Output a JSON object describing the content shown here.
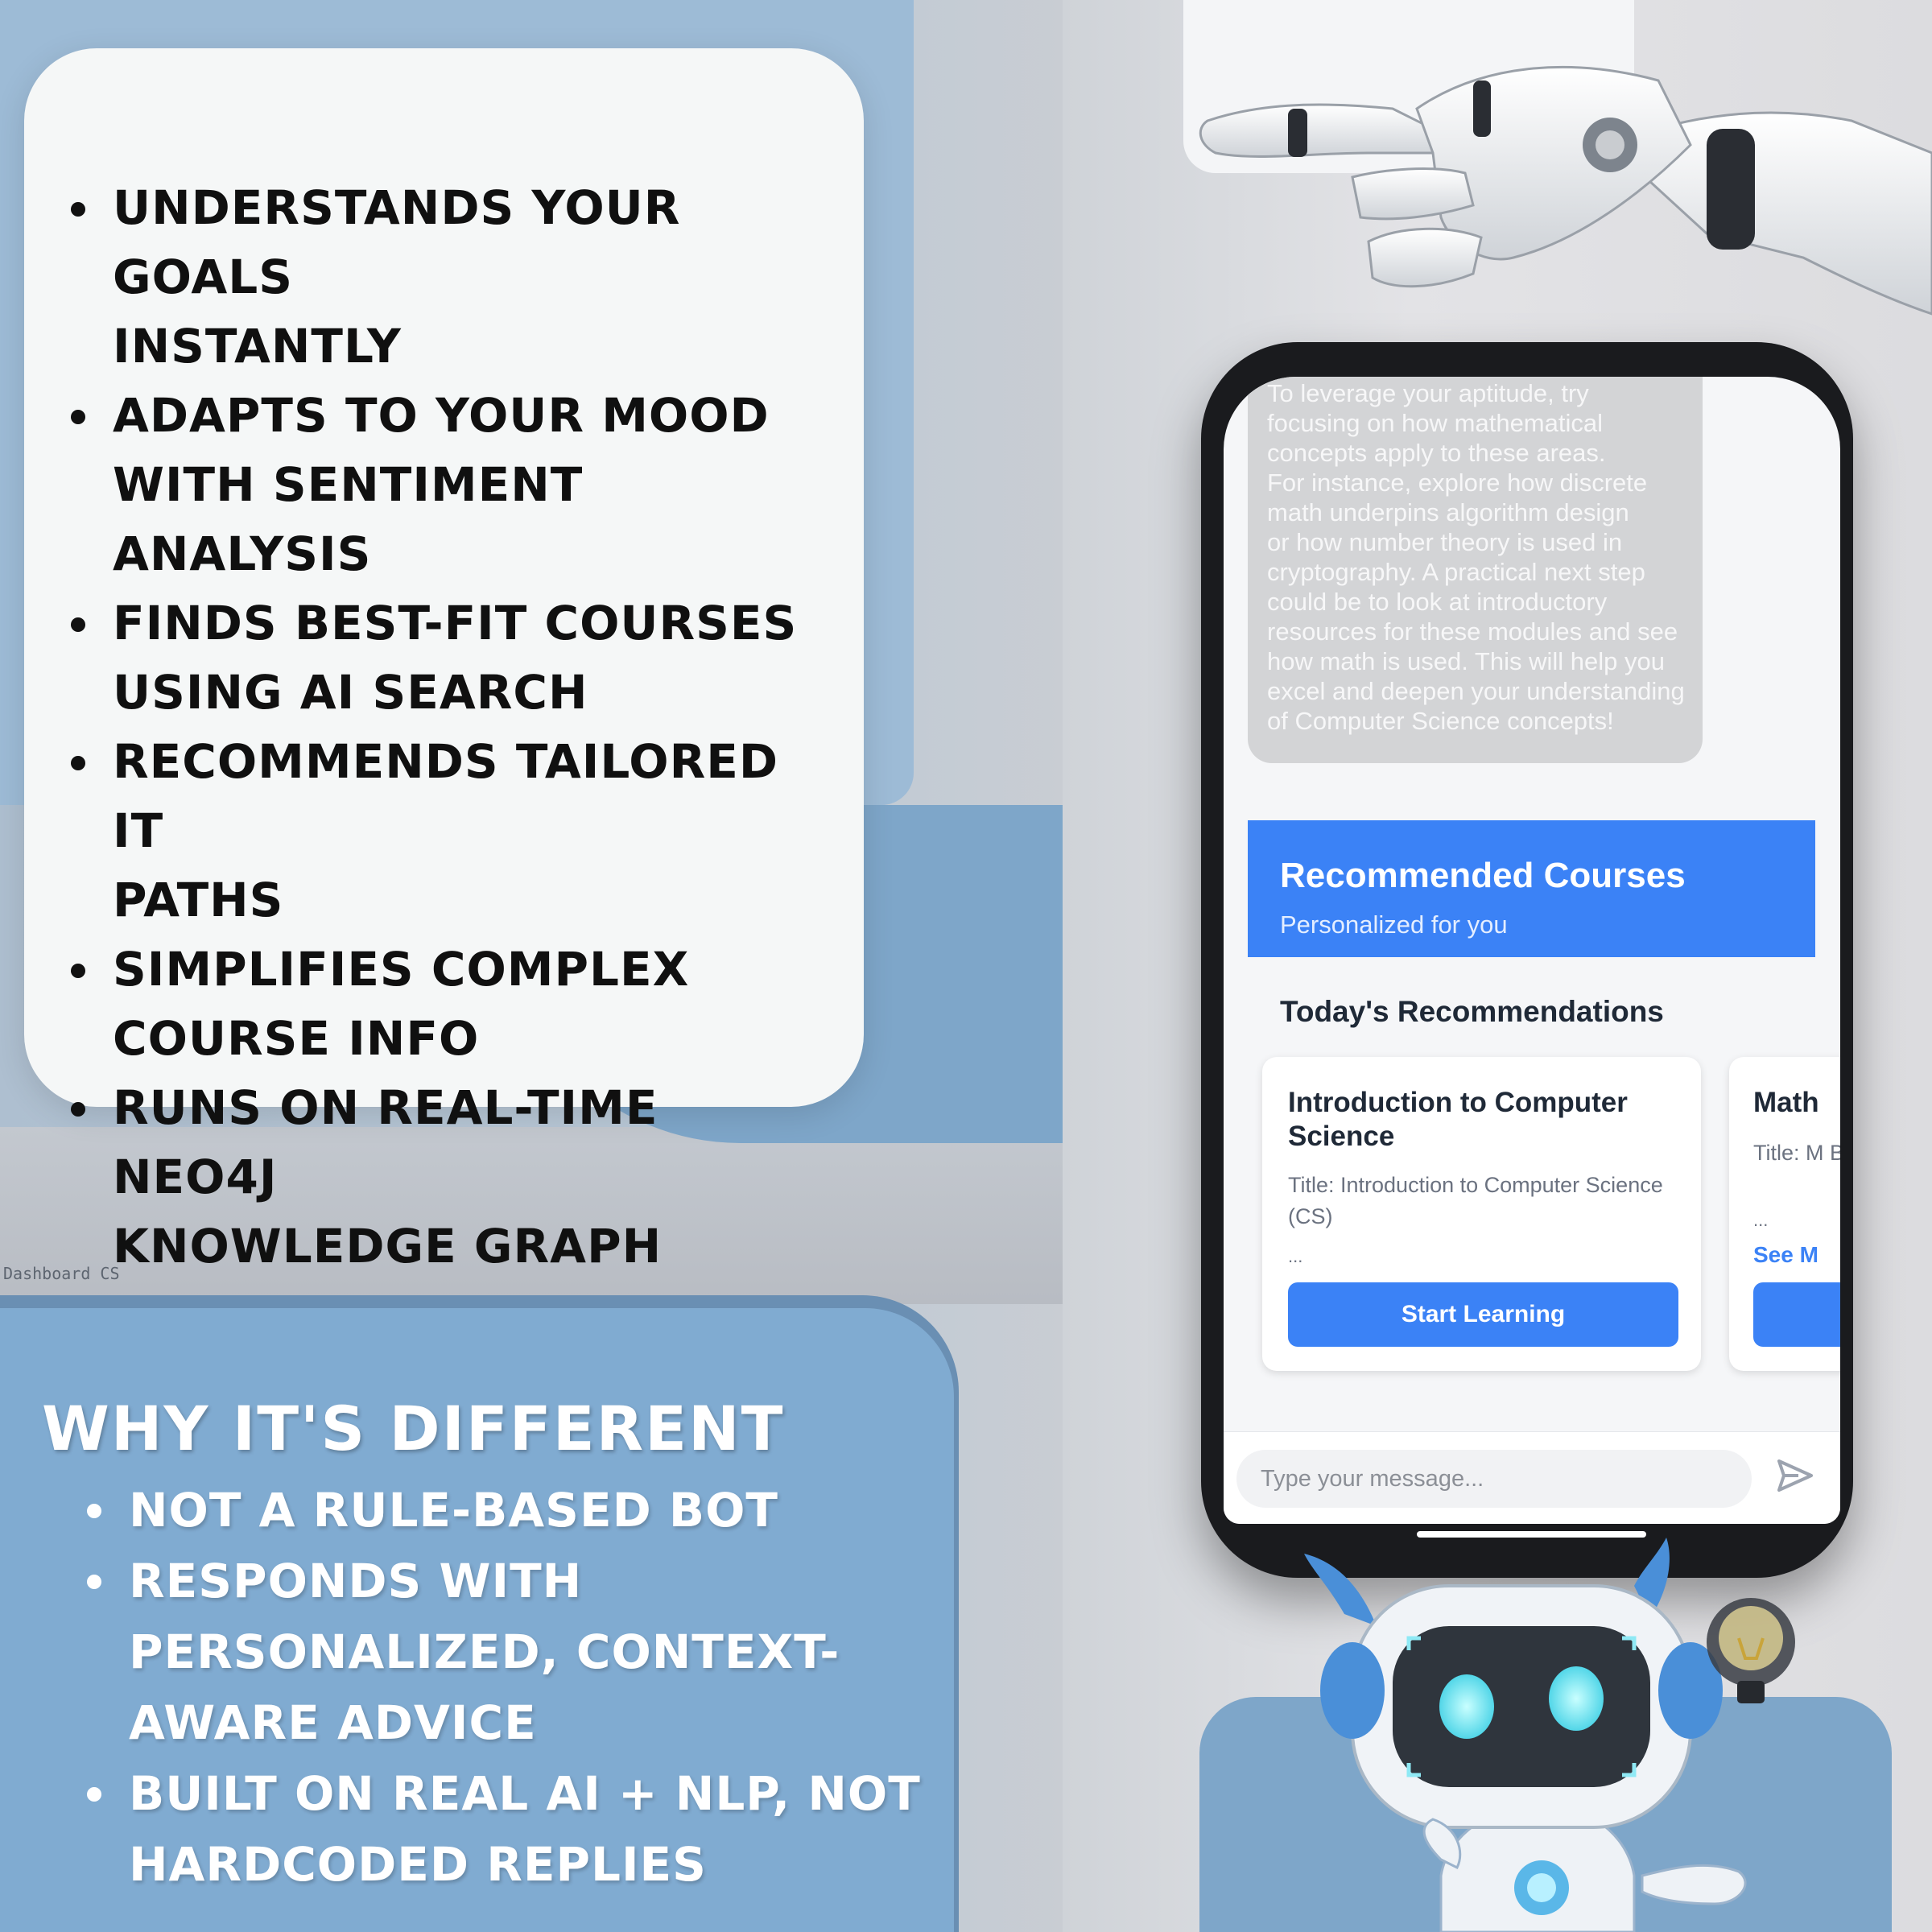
{
  "features": {
    "items": [
      [
        "UNDERSTANDS YOUR GOALS",
        "INSTANTLY"
      ],
      [
        "ADAPTS TO YOUR MOOD",
        "WITH SENTIMENT ANALYSIS"
      ],
      [
        "FINDS BEST-FIT COURSES",
        "USING AI SEARCH"
      ],
      [
        "RECOMMENDS TAILORED IT",
        "PATHS"
      ],
      [
        "SIMPLIFIES COMPLEX",
        "COURSE INFO"
      ],
      [
        "RUNS ON REAL-TIME NEO4J",
        "KNOWLEDGE GRAPH"
      ]
    ]
  },
  "why": {
    "title": "WHY IT'S DIFFERENT",
    "items": [
      [
        "NOT A RULE-BASED BOT"
      ],
      [
        "RESPONDS WITH",
        "PERSONALIZED, CONTEXT-",
        "AWARE ADVICE"
      ],
      [
        "BUILT ON REAL AI + NLP, NOT",
        "HARDCODED REPLIES"
      ]
    ]
  },
  "watermark": "Dashboard CS",
  "phone": {
    "chat_bubble_lines": [
      "To leverage your aptitude, try",
      "focusing on how mathematical",
      "concepts apply to these areas.",
      "For instance, explore how discrete",
      "math underpins algorithm design",
      "or how number theory is used in",
      "cryptography. A practical next step",
      "could be to look at introductory",
      "resources for these modules and see",
      "how math is used. This will help you",
      "excel and deepen your understanding",
      "of Computer Science concepts!"
    ],
    "rec_header": {
      "title": "Recommended Courses",
      "subtitle": "Personalized for you"
    },
    "today_label": "Today's Recommendations",
    "courses": [
      {
        "title": "Introduction to Computer Science",
        "desc": "Title: Introduction to Computer Science (CS)",
        "ellipsis": "...",
        "button": "Start Learning"
      },
      {
        "title": "Math",
        "desc": "Title: M Beginr",
        "ellipsis": "...",
        "see_more": "See M",
        "button": ""
      }
    ],
    "input": {
      "placeholder": "Type your message..."
    },
    "send_icon": "send-icon"
  },
  "colors": {
    "accent": "#3b82f6",
    "why_panel": "#80abd1",
    "feature_card": "#f5f7f7"
  }
}
